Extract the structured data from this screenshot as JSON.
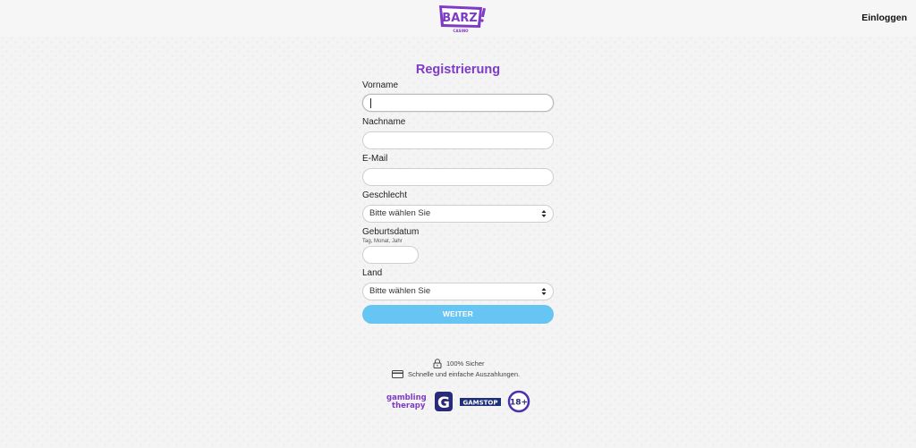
{
  "header": {
    "logo_text": "BARZ",
    "logo_subtext": "CASINO",
    "login_label": "Einloggen"
  },
  "form": {
    "title": "Registrierung",
    "first_name": {
      "label": "Vorname",
      "value": ""
    },
    "last_name": {
      "label": "Nachname",
      "value": ""
    },
    "email": {
      "label": "E-Mail",
      "value": ""
    },
    "gender": {
      "label": "Geschlecht",
      "selected": "Bitte wählen Sie"
    },
    "birthdate": {
      "label": "Geburtsdatum",
      "hint": "Tag, Monat, Jahr",
      "value": ""
    },
    "country": {
      "label": "Land",
      "selected": "Bitte wählen Sie"
    },
    "submit_label": "WEITER"
  },
  "trust": {
    "secure": "100% Sicher",
    "payouts": "Schnelle und einfache Auszahlungen."
  },
  "badges": {
    "gambling_therapy_line1": "gambling",
    "gambling_therapy_line2": "therapy",
    "gamcare_letter": "G",
    "gamstop": "GAMSTOP",
    "age": "18+"
  },
  "colors": {
    "brand_purple": "#7e3bc4",
    "button_blue": "#67c5f3",
    "background": "#f4f4f4"
  }
}
